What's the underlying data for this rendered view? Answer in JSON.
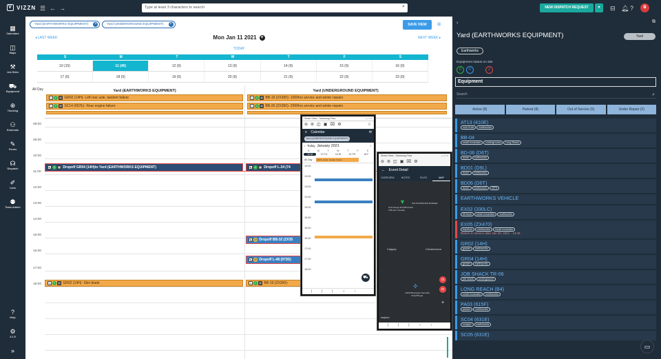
{
  "app": {
    "name": "VIZZN",
    "search_placeholder": "Type at least 3 characters to search",
    "dispatch_label": "NEW DISPATCH REQUEST",
    "user_initial": "B"
  },
  "nav": [
    {
      "label": "Calendars",
      "icon": "calendar-icon"
    },
    {
      "label": "Maps",
      "icon": "map-icon"
    },
    {
      "label": "Job Sites",
      "icon": "job-sites-icon"
    },
    {
      "label": "Equipment",
      "icon": "equipment-icon"
    },
    {
      "label": "Tracking",
      "icon": "tracking-icon"
    },
    {
      "label": "Externals",
      "icon": "externals-icon"
    },
    {
      "label": "Forms",
      "icon": "forms-icon"
    },
    {
      "label": "Dispatch",
      "icon": "dispatch-icon"
    },
    {
      "label": "Lists",
      "icon": "lists-icon"
    },
    {
      "label": "Team Admin",
      "icon": "team-admin-icon"
    }
  ],
  "nav_bottom": {
    "help": "Help",
    "version": "3.1.5"
  },
  "filters": {
    "chip1": "Yard (EARTHWORKS EQUIPMENT)",
    "chip2": "Yard (UNDERGROUND EQUIPMENT)",
    "save_view": "SAVE VIEW"
  },
  "calendar": {
    "prev": "LAST WEEK",
    "next": "NEXT WEEK",
    "title": "Mon Jan 11 2021",
    "today": "TODAY",
    "weekdays": [
      "S",
      "M",
      "T",
      "W",
      "T",
      "F",
      "S"
    ],
    "week1": [
      "10 (15)",
      "11 (46)",
      "12 (9)",
      "13 (9)",
      "14 (9)",
      "15 (9)",
      "16 (0)"
    ],
    "week2": [
      "17 (0)",
      "18 (9)",
      "19 (9)",
      "20 (9)",
      "21 (9)",
      "22 (9)",
      "23 (0)"
    ],
    "allday": "All Day",
    "res1": "Yard (EARTHWORKS EQUIPMENT)",
    "res2": "Yard (UNDERGROUND EQUIPMENT)",
    "times": [
      "08:00",
      "09:00",
      "10:00",
      "11:00",
      "12:00",
      "13:00",
      "14:00",
      "15:00",
      "16:00",
      "17:00",
      "18:00"
    ],
    "events": {
      "a1": "GR02 (14H)- Left rear axle, tandem failure",
      "a2": "SC14 (657E)- Rear engine failure",
      "a3": "BB-19 (ZX300)- 1000hrs service and winter repairs",
      "a4": "BB-26 (ZX350)- 2000hrs service and winter repairs",
      "d1": "Dropoff GR04 (14H)to Yard (EARTHWORKS EQUIPMENT)",
      "d2": "Dropoff L-34 (74",
      "s1": "Dropoff BB-32 (ZX35",
      "s2": "Dropoff L-48 (973D)",
      "g1": "GR02 (14H)- Slim blade",
      "g2": "BB-19 (ZX300)-"
    }
  },
  "phone1": {
    "window": "Smart View - Samsung Flow",
    "app": "Calendar",
    "filter": "Yard (UNDERGROUND EQUIPMENT)",
    "today": "Today",
    "month": "January 2021",
    "wd": [
      "S",
      "M",
      "T",
      "W",
      "T",
      "F",
      "S"
    ],
    "days": [
      "11 M",
      "12 TU",
      "13 W",
      "14 TH",
      "15 F"
    ],
    "allday": "All Day",
    "event": "GR01 (14H)- Grader Frame",
    "times": [
      "13:00",
      "13:30",
      "14:00",
      "14:30",
      "15:00",
      "15:30",
      "16:00",
      "16:30",
      "17:00",
      "17:30",
      "18:00"
    ]
  },
  "phone2": {
    "window": "Smart View - Samsung Flow",
    "title": "Event Detail",
    "tabs": [
      "OVERVIEW",
      "NOTES",
      "FILES",
      "MAP"
    ],
    "pin_label": "#711 Range Rd 285 Airdrie T4B 2A3, Canada",
    "dest_label": "SOUTHGROUND BURGER",
    "city1": "Calgary",
    "city2": "Chestermere",
    "footer_pin": "13230 Bearspaw Township Road Burger",
    "mapbox": "mapbox"
  },
  "right": {
    "title": "Yard (EARTHWORKS EQUIPMENT)",
    "badge": "Yard",
    "chip": "Earthworks",
    "status_label": "Equipment status on site",
    "counts": [
      "0",
      "0",
      "2"
    ],
    "section": "Equipment",
    "search": "Search",
    "tabs": [
      "Active (8)",
      "Parked (8)",
      "Out of Service (5)",
      "Under Repair (2)"
    ],
    "items": [
      {
        "name": "AT13 (410E)",
        "tags": [
          "rock truck",
          "earthworks"
        ]
      },
      {
        "name": "BB-04",
        "tags": [
          "small excavator",
          "underground",
          "Long Reach"
        ]
      },
      {
        "name": "BD-06 (D6T)",
        "tags": [
          "dozer",
          "earthworks"
        ]
      },
      {
        "name": "BD01 (D9L)",
        "tags": [
          "dozer",
          "earthworks"
        ]
      },
      {
        "name": "BD06 (D6T)",
        "tags": [
          "dozer",
          "earthworks",
          "GPS"
        ]
      },
      {
        "name": "EARTHWORKS VEHICLE",
        "tags": []
      },
      {
        "name": "EX02 (330LC)",
        "tags": [
          "lift truck",
          "small excavator",
          "earthworks"
        ]
      },
      {
        "name": "EX05 (ZX470)",
        "tags": [
          "backhoe",
          "earthworks",
          "small excavator"
        ],
        "note": "Return to service date Jan 30, 2021 - 13:45"
      },
      {
        "name": "GR02 (14H)",
        "tags": [
          "grader",
          "earthworks"
        ]
      },
      {
        "name": "GR04 (14H)",
        "tags": [
          "grader",
          "earthworks"
        ]
      },
      {
        "name": "JOB SHACK TR-06",
        "tags": [
          "job shack",
          "underground"
        ]
      },
      {
        "name": "LONG REACH (B4)",
        "tags": [
          "small excavator",
          "earthworks"
        ]
      },
      {
        "name": "PA03 (615F)",
        "tags": [
          "packer",
          "earthworks"
        ]
      },
      {
        "name": "SC04 (631E)",
        "tags": [
          "scraper",
          "earthworks"
        ]
      },
      {
        "name": "SC05 (631E)",
        "tags": []
      }
    ]
  },
  "colors": {
    "nav_bg": "#1f2d3a",
    "accent": "#14b5cf",
    "event_orange": "#f2a94a",
    "event_blue": "#2d4d74",
    "teal": "#1aa99e"
  }
}
